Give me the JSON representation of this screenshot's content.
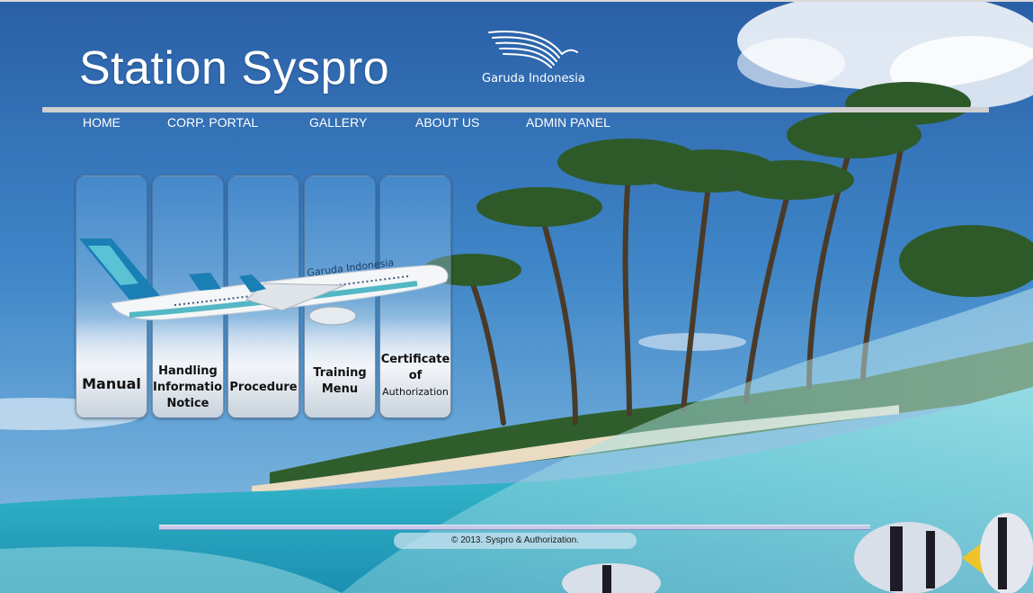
{
  "header": {
    "title": "Station Syspro",
    "logo_text": "Garuda Indonesia"
  },
  "nav": {
    "items": [
      {
        "id": "home",
        "label": "HOME"
      },
      {
        "id": "corp-portal",
        "label": "CORP. PORTAL"
      },
      {
        "id": "gallery",
        "label": "GALLERY"
      },
      {
        "id": "about-us",
        "label": "ABOUT US"
      },
      {
        "id": "admin-panel",
        "label": "ADMIN PANEL"
      }
    ]
  },
  "panels": [
    {
      "id": "manual",
      "lines": [
        "Manual"
      ]
    },
    {
      "id": "handling-information-notice",
      "lines": [
        "Handling",
        "Information",
        "Notice"
      ]
    },
    {
      "id": "procedure",
      "lines": [
        "Procedure"
      ]
    },
    {
      "id": "training-menu",
      "lines": [
        "Training",
        "Menu"
      ]
    },
    {
      "id": "certificate-of-authorization",
      "lines": [
        "Certificate",
        "of",
        "Authorization"
      ]
    }
  ],
  "plane_livery_text": "Garuda Indonesia",
  "footer": {
    "copyright": "© 2013. Syspro & Authorization."
  },
  "colors": {
    "sky": "#2f6fae",
    "sea": "#35b7c8",
    "nav_text": "#ffffff",
    "header_rule": "#cfcfcf"
  }
}
